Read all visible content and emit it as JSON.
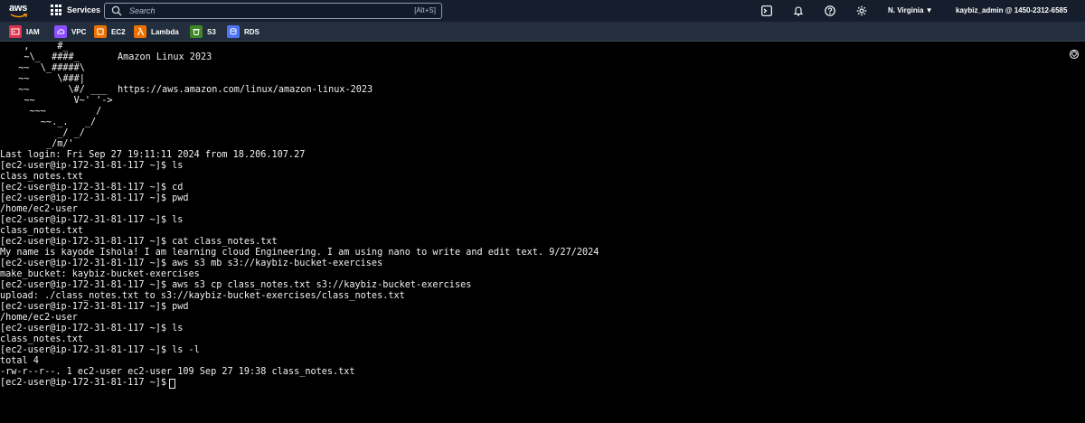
{
  "nav": {
    "logo_text": "aws",
    "services_label": "Services",
    "search_placeholder": "Search",
    "search_shortcut": "[Alt+S]",
    "region": "N. Virginia",
    "account": "kaybiz_admin @ 1450-2312-6585"
  },
  "favorites": [
    {
      "label": "IAM",
      "icon": "iam-icon",
      "color": "#dd344c"
    },
    {
      "label": "VPC",
      "icon": "vpc-icon",
      "color": "#8c4fff"
    },
    {
      "label": "EC2",
      "icon": "ec2-icon",
      "color": "#ed7100"
    },
    {
      "label": "Lambda",
      "icon": "lambda-icon",
      "color": "#ed7100"
    },
    {
      "label": "S3",
      "icon": "s3-icon",
      "color": "#3f8624"
    },
    {
      "label": "RDS",
      "icon": "rds-icon",
      "color": "#4d72f3"
    }
  ],
  "terminal": {
    "ascii_art": "   ,     #_\n   ~\\_  ####_\n  ~~  \\_#####\\\n  ~~     \\###|\n  ~~       \\#/ ___\n   ~~       V~' '->\n    ~~~         /\n      ~~._.   _/\n         _/ _/\n       _/m/'",
    "banner_title": "Amazon Linux 2023",
    "banner_url": "https://aws.amazon.com/linux/amazon-linux-2023",
    "lines": [
      "Last login: Fri Sep 27 19:11:11 2024 from 18.206.107.27",
      "[ec2-user@ip-172-31-81-117 ~]$ ls",
      "class_notes.txt",
      "[ec2-user@ip-172-31-81-117 ~]$ cd",
      "[ec2-user@ip-172-31-81-117 ~]$ pwd",
      "/home/ec2-user",
      "[ec2-user@ip-172-31-81-117 ~]$ ls",
      "class_notes.txt",
      "[ec2-user@ip-172-31-81-117 ~]$ cat class_notes.txt",
      "My name is kayode Ishola! I am learning cloud Engineering. I am using nano to write and edit text. 9/27/2024",
      "[ec2-user@ip-172-31-81-117 ~]$ aws s3 mb s3://kaybiz-bucket-exercises",
      "make_bucket: kaybiz-bucket-exercises",
      "[ec2-user@ip-172-31-81-117 ~]$ aws s3 cp class_notes.txt s3://kaybiz-bucket-exercises",
      "upload: ./class_notes.txt to s3://kaybiz-bucket-exercises/class_notes.txt",
      "[ec2-user@ip-172-31-81-117 ~]$ pwd",
      "/home/ec2-user",
      "[ec2-user@ip-172-31-81-117 ~]$ ls",
      "class_notes.txt",
      "[ec2-user@ip-172-31-81-117 ~]$ ls -l",
      "total 4",
      "-rw-r--r--. 1 ec2-user ec2-user 109 Sep 27 19:38 class_notes.txt"
    ],
    "prompt": "[ec2-user@ip-172-31-81-117 ~]$"
  }
}
